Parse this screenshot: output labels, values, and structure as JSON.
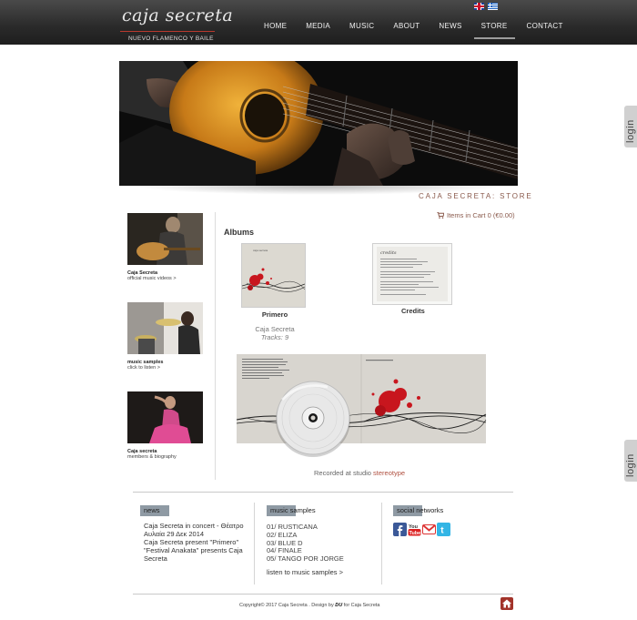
{
  "header": {
    "logo_script": "caja secreta",
    "logo_sub": "NUEVO FLAMENCO Y BAILE",
    "nav": [
      "HOME",
      "MEDIA",
      "MUSIC",
      "ABOUT",
      "NEWS",
      "STORE",
      "CONTACT"
    ],
    "active_nav": "STORE",
    "flags": [
      "uk-flag-icon",
      "greek-flag-icon"
    ]
  },
  "login_label": "login",
  "store": {
    "title": "CAJA SECRETA: STORE",
    "cart": "Items in Cart  0 (€0.00)",
    "albums_heading": "Albums"
  },
  "sidebar": {
    "items": [
      {
        "title": "Caja Secreta",
        "sub": "official music videos >"
      },
      {
        "title": "music samples",
        "sub": "click to listen >"
      },
      {
        "title": "Caja secreta",
        "sub": "members & biography"
      }
    ]
  },
  "album": {
    "name": "Primero",
    "artist": "Caja Secreta",
    "tracks": "Tracks: 9"
  },
  "credits_label": "Credits",
  "recorded": {
    "prefix": "Recorded at studio ",
    "studio": "stereotype"
  },
  "footer": {
    "news": {
      "tag": "news",
      "items": [
        "Caja Secreta in concert - Θέατρο Αυλαία 29 Δεκ 2014",
        "Caja Secreta present \"Primero\"",
        "\"Festival Anakata\" presents Caja Secreta"
      ]
    },
    "music": {
      "tag": "music samples",
      "tracks": [
        "01/ RUSTICANA",
        "02/ ELIZA",
        "03/ BLUE D",
        "04/ FINALE",
        "05/ TANGO POR JORGE"
      ],
      "listen": "listen to music samples >"
    },
    "social": {
      "tag": "social networks",
      "icons": [
        "facebook-icon",
        "youtube-icon",
        "gmail-icon",
        "twitter-icon"
      ]
    },
    "copyright_pre": "Copyright© 2017 Caja Secreta . Design by ",
    "copyright_brand": "DU",
    "copyright_post": " for Caja Secreta"
  },
  "colors": {
    "accent": "#b05040",
    "header_dark": "#2a2a2a",
    "tag_gray": "#8f9aa4"
  }
}
